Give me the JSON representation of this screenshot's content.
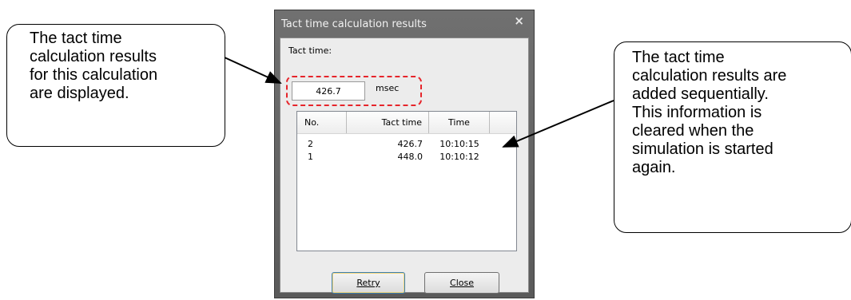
{
  "callouts": {
    "left": "The tact time\ncalculation results\nfor this calculation\nare displayed.",
    "right": "The tact time\ncalculation results are\nadded sequentially.\nThis information is\ncleared when the\nsimulation is started\nagain."
  },
  "dialog": {
    "title": "Tact time calculation results",
    "close_glyph": "×",
    "tact_label": "Tact time:",
    "tact_value": "426.7",
    "unit": "msec",
    "columns": {
      "no": "No.",
      "tact": "Tact time",
      "time": "Time"
    },
    "rows": [
      {
        "no": "2",
        "tact": "426.7",
        "time": "10:10:15"
      },
      {
        "no": "1",
        "tact": "448.0",
        "time": "10:10:12"
      }
    ],
    "retry_label": "Retry",
    "close_label": "Close"
  },
  "colors": {
    "highlight": "#e6252b",
    "titlebar": "#5f5f5f"
  }
}
